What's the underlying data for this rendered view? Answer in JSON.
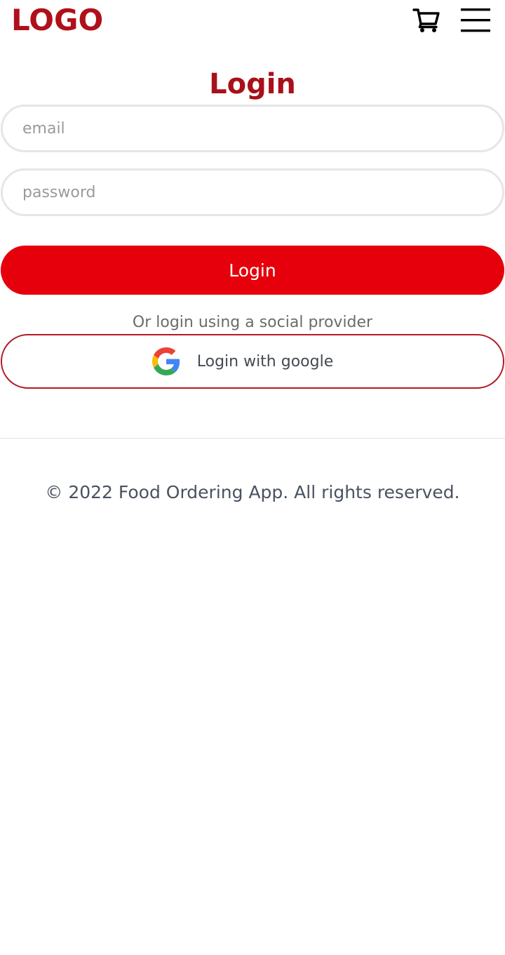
{
  "header": {
    "logo": "LOGO",
    "cart_icon": "cart-icon",
    "menu_icon": "hamburger-menu-icon"
  },
  "login_form": {
    "title": "Login",
    "email_placeholder": "email",
    "email_value": "",
    "password_placeholder": "password",
    "password_value": "",
    "submit_label": "Login",
    "social_text": "Or login using a social provider",
    "google_label": "Login with google",
    "google_icon": "google-icon"
  },
  "footer": {
    "copyright": "© 2022 Food Ordering App. All rights reserved."
  },
  "colors": {
    "brand": "#b0101a",
    "button": "#e5000c",
    "google_border": "#b31924",
    "input_border": "#e6e6e6"
  }
}
